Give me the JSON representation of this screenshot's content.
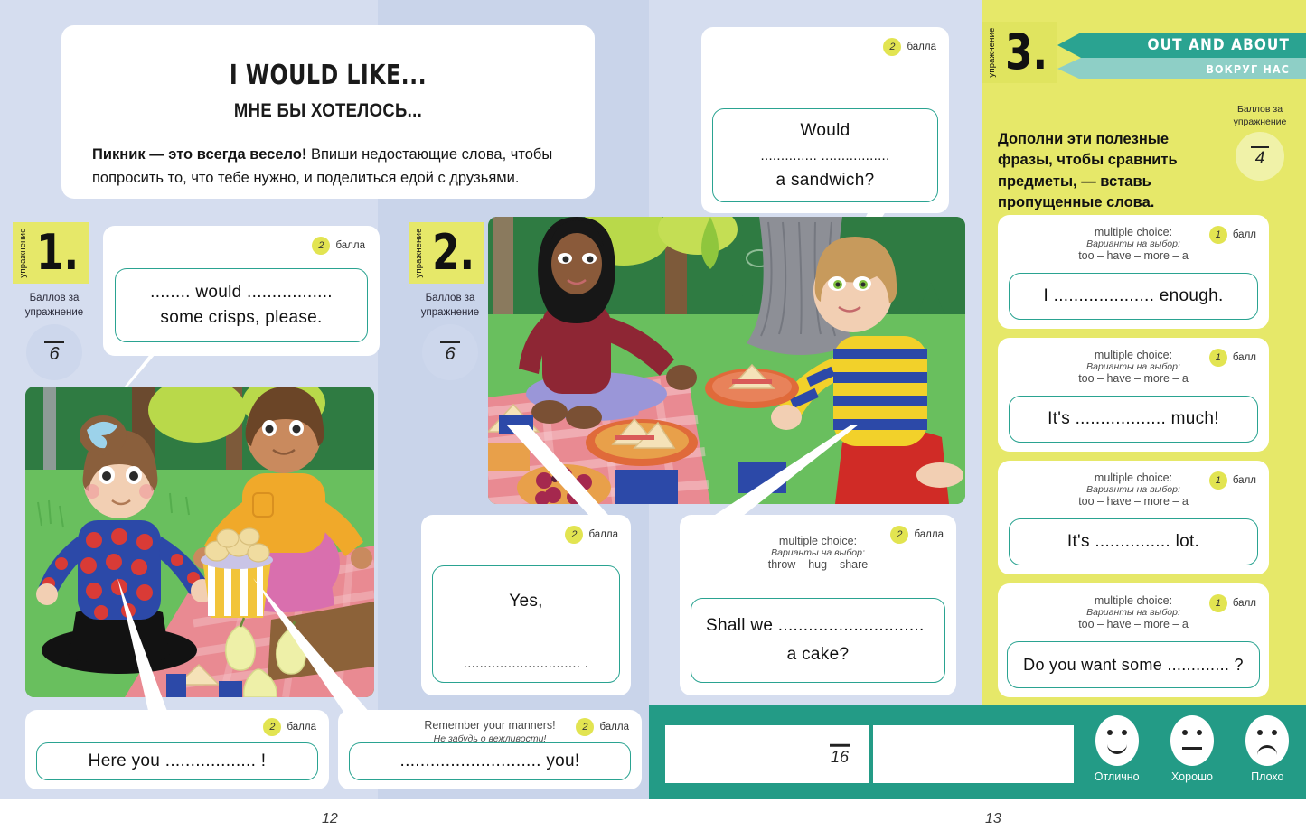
{
  "spread": {
    "page_left_number": "12",
    "page_right_number": "13"
  },
  "title_card": {
    "title_en": "I WOULD LIKE...",
    "title_ru": "МНЕ БЫ ХОТЕЛОСЬ...",
    "body_bold": "Пикник — это всегда весело!",
    "body_rest": " Впиши недостающие слова, чтобы попросить то, что тебе нужно, и поделиться едой с друзьями."
  },
  "exercise1": {
    "vertical_label": "упражнение",
    "number": "1.",
    "score_caption_line1": "Баллов за",
    "score_caption_line2": "упражнение",
    "score_denominator": "6"
  },
  "exercise2": {
    "vertical_label": "упражнение",
    "number": "2.",
    "score_caption_line1": "Баллов за",
    "score_caption_line2": "упражнение",
    "score_denominator": "6"
  },
  "exercise3": {
    "vertical_label": "упражнение",
    "number": "3.",
    "banner_en": "OUT AND ABOUT",
    "banner_ru": "ВОКРУГ НАС",
    "instruction": "Дополни эти полезные фразы, чтобы сравнить предметы, — вставь пропущенные слова.",
    "score_caption_line1": "Баллов за",
    "score_caption_line2": "упражнение",
    "score_denominator": "4"
  },
  "points_labels": {
    "two": "балла",
    "one": "балл"
  },
  "mc_labels": {
    "en": "multiple choice:",
    "ru": "Варианты на выбор:"
  },
  "cards": {
    "crisps": {
      "points": "2",
      "points_label": "балла",
      "line1": "........  would  .................",
      "line2": "some crisps, please."
    },
    "here_you": {
      "points": "2",
      "points_label": "балла",
      "line1": "Here you .................. !"
    },
    "manners": {
      "points": "2",
      "points_label": "балла",
      "prompt_en": "Remember your manners!",
      "prompt_ru": "Не забудь о вежливости!",
      "line1": "............................ you!"
    },
    "sandwich": {
      "points": "2",
      "points_label": "балла",
      "line1": "Would",
      "line2": "..............   .................",
      "line3": "a sandwich?"
    },
    "yes": {
      "points": "2",
      "points_label": "балла",
      "line1": "Yes,",
      "line2": "............................. ."
    },
    "cake": {
      "points": "2",
      "points_label": "балла",
      "mc_en": "multiple choice:",
      "mc_ru": "Варианты на выбор:",
      "options": "throw – hug – share",
      "line1": "Shall we .............................",
      "line2": "a cake?"
    }
  },
  "mc_cards": [
    {
      "points": "1",
      "points_label": "балл",
      "mc_en": "multiple choice:",
      "mc_ru": "Варианты на выбор:",
      "options": "too – have – more – a",
      "sentence": "I .................... enough."
    },
    {
      "points": "1",
      "points_label": "балл",
      "mc_en": "multiple choice:",
      "mc_ru": "Варианты на выбор:",
      "options": "too – have – more – a",
      "sentence": "It's  .................. much!"
    },
    {
      "points": "1",
      "points_label": "балл",
      "mc_en": "multiple choice:",
      "mc_ru": "Варианты на выбор:",
      "options": "too – have – more – a",
      "sentence": "It's ............... lot."
    },
    {
      "points": "1",
      "points_label": "балл",
      "mc_en": "multiple choice:",
      "mc_ru": "Варианты на выбор:",
      "options": "too – have – more – a",
      "sentence": "Do you want some ............. ?"
    }
  ],
  "total_bar": {
    "denominator": "16",
    "faces": [
      {
        "icon": "smiley-face-icon",
        "label": "Отлично"
      },
      {
        "icon": "neutral-face-icon",
        "label": "Хорошо"
      },
      {
        "icon": "sad-face-icon",
        "label": "Плохо"
      }
    ]
  },
  "colors": {
    "page_bg": "#d5ddef",
    "page_bg_gutter": "#c9d4ea",
    "yellow_panel": "#e6e869",
    "teal": "#2aa391",
    "teal_light": "#8ecfc6",
    "teal_bar": "#239b86",
    "point_dot": "#e2e451"
  }
}
